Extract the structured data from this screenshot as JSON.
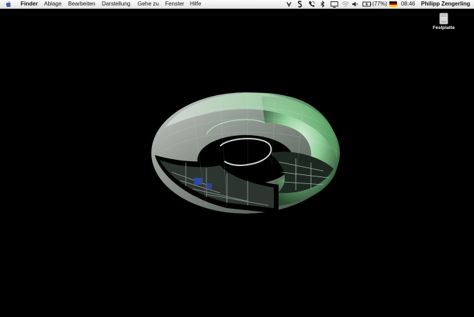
{
  "menubar": {
    "apple_icon": "apple-icon",
    "items": [
      {
        "label": "Finder"
      },
      {
        "label": "Ablage"
      },
      {
        "label": "Bearbeiten"
      },
      {
        "label": "Darstellung"
      },
      {
        "label": "Gehe zu"
      },
      {
        "label": "Fenster"
      },
      {
        "label": "Hilfe"
      }
    ],
    "status": {
      "icons": [
        "apple-script-icon",
        "sync-icon",
        "phone-icon",
        "bluetooth-icon",
        "display-icon",
        "wifi-icon",
        "volume-icon",
        "battery-icon",
        "german-flag-icon"
      ],
      "battery_text": "(77%)",
      "clock": "08:46",
      "user": "Philipp Zengerling"
    }
  },
  "desktop": {
    "icons": [
      {
        "label": "Festplatte",
        "icon": "hard-drive-icon"
      }
    ],
    "wallpaper": "green-torus-space-station"
  }
}
